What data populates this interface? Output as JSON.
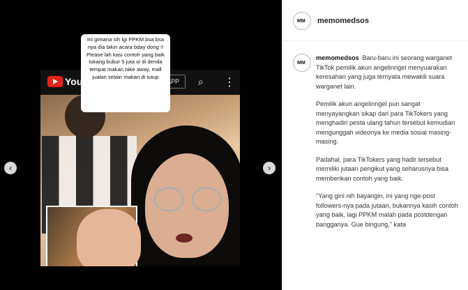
{
  "media": {
    "youtube_word": "YouTube",
    "app_label": "APP",
    "caption": "Ini gimana sih lgi PPKM bsa bsa nya dia bikin acara bday dong !! Please lah kasi contoh yang baik tukang bubur 5 juta oi di denda tempat makan take away, mall jualan selain makan di tutup",
    "nav_left": "‹",
    "nav_right": "›"
  },
  "panel": {
    "top_username": "memomedsos",
    "post_username": "memomedsos",
    "p1": "Baru-baru ini seorang warganet TikTok pemilik akun angelinngel menyuarakan keresahan yang juga ternyata mewakili suara warganet lain.",
    "p2": "Pemilik akun angelinngel pun sangat menyayangkan sikap dari para TikTokers yang menghadiri pesta ulang tahun tersebut kemudian mengunggah videonya ke media sosial masing-masing.",
    "p3": "Padahal, para TikTokers yang hadir tersebut memiliki jutaan pengikut yang seharusnya bisa memberikan contoh yang baik.",
    "p4": "\"Yang gini nih bayangin, ini yang nge-post followers-nya pada jutaan, bukannya kasih contoh yang baik, lagi PPKM malah pada postdengan bangganya. Gue bingung,\" kata"
  }
}
